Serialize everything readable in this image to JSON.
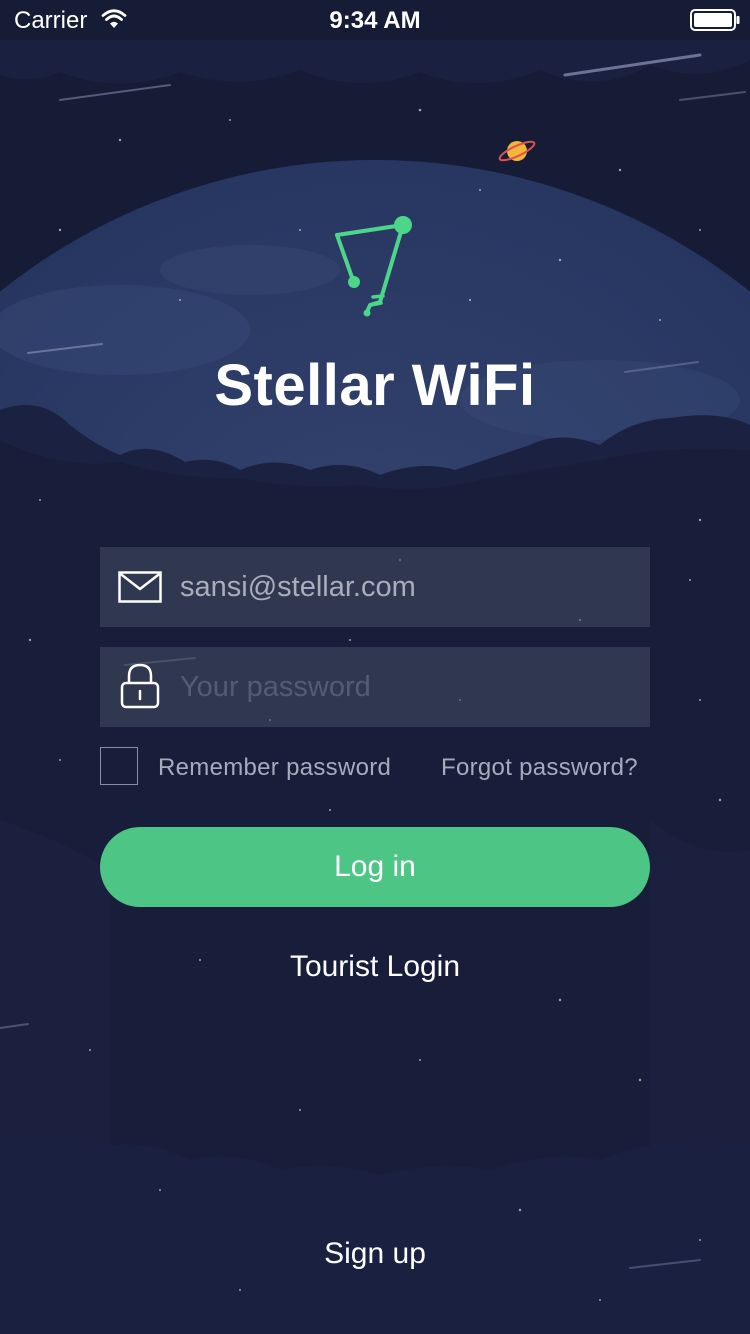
{
  "status_bar": {
    "carrier": "Carrier",
    "time": "9:34 AM"
  },
  "brand": {
    "app_name": "Stellar WiFi",
    "accent_color": "#4cc585",
    "background_color": "#161c35"
  },
  "login_form": {
    "email_value": "sansi@stellar.com",
    "password_placeholder": "Your password",
    "remember_label": "Remember password",
    "remember_checked": false,
    "forgot_label": "Forgot password?",
    "login_label": "Log in"
  },
  "links": {
    "tourist_login": "Tourist Login",
    "sign_up": "Sign up"
  },
  "icons": {
    "email": "envelope-icon",
    "password": "lock-icon",
    "logo": "constellation-logo-icon",
    "wifi": "wifi-icon",
    "battery": "battery-icon"
  }
}
